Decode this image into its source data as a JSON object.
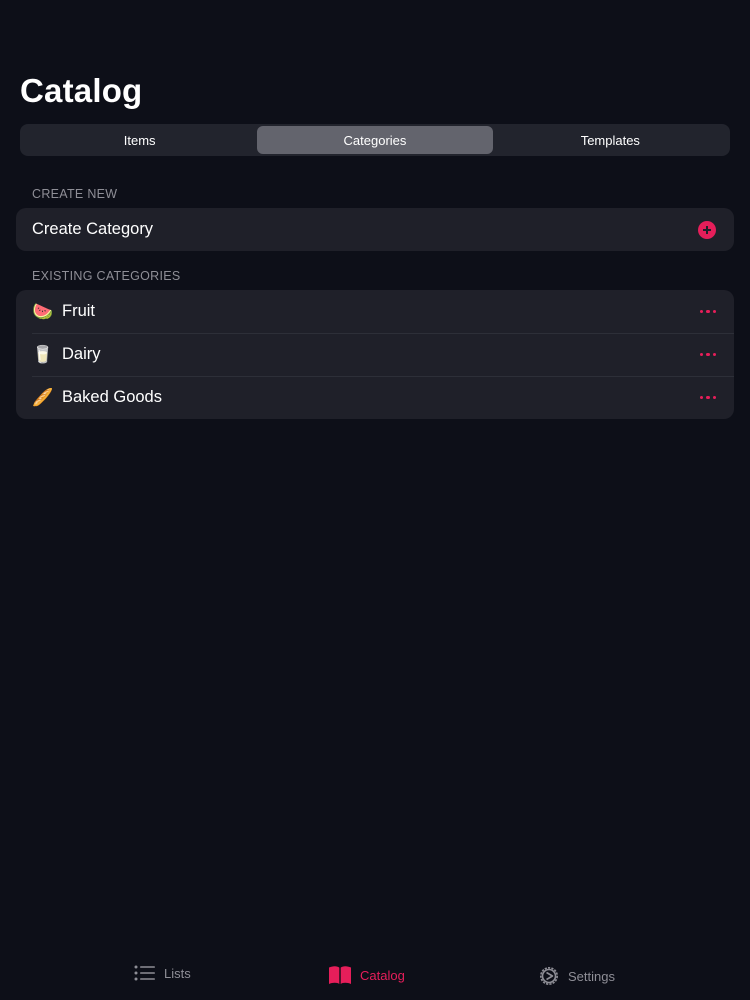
{
  "header": {
    "title": "Catalog"
  },
  "segments": [
    {
      "label": "Items",
      "active": false
    },
    {
      "label": "Categories",
      "active": true
    },
    {
      "label": "Templates",
      "active": false
    }
  ],
  "create_section": {
    "header": "CREATE NEW",
    "create_label": "Create Category",
    "icon": "plus-circle-icon"
  },
  "existing_section": {
    "header": "EXISTING CATEGORIES",
    "items": [
      {
        "emoji": "🍉",
        "label": "Fruit",
        "icon": "more-icon"
      },
      {
        "emoji": "🥛",
        "label": "Dairy",
        "icon": "more-icon"
      },
      {
        "emoji": "🥖",
        "label": "Baked Goods",
        "icon": "more-icon"
      }
    ]
  },
  "tabbar": {
    "items": [
      {
        "label": "Lists",
        "icon": "list-icon",
        "active": false
      },
      {
        "label": "Catalog",
        "icon": "book-icon",
        "active": true
      },
      {
        "label": "Settings",
        "icon": "gear-icon",
        "active": false
      }
    ]
  },
  "colors": {
    "background": "#0d0f18",
    "card": "#1f2029",
    "accent": "#e61e5a",
    "secondary_text": "#8e8e96"
  }
}
